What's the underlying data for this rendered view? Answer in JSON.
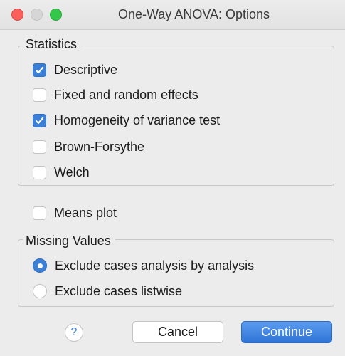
{
  "window": {
    "title": "One-Way ANOVA: Options"
  },
  "statistics": {
    "legend": "Statistics",
    "items": [
      {
        "label": "Descriptive",
        "checked": true
      },
      {
        "label": "Fixed and random effects",
        "checked": false
      },
      {
        "label": "Homogeneity of variance test",
        "checked": true
      },
      {
        "label": "Brown-Forsythe",
        "checked": false
      },
      {
        "label": "Welch",
        "checked": false
      }
    ]
  },
  "means_plot": {
    "label": "Means plot",
    "checked": false
  },
  "missing_values": {
    "legend": "Missing Values",
    "options": [
      {
        "label": "Exclude cases analysis by analysis",
        "selected": true
      },
      {
        "label": "Exclude cases listwise",
        "selected": false
      }
    ]
  },
  "footer": {
    "help_label": "?",
    "cancel_label": "Cancel",
    "continue_label": "Continue"
  },
  "colors": {
    "accent": "#3b7fd6",
    "close": "#fc605c",
    "maximize": "#34c84a"
  }
}
